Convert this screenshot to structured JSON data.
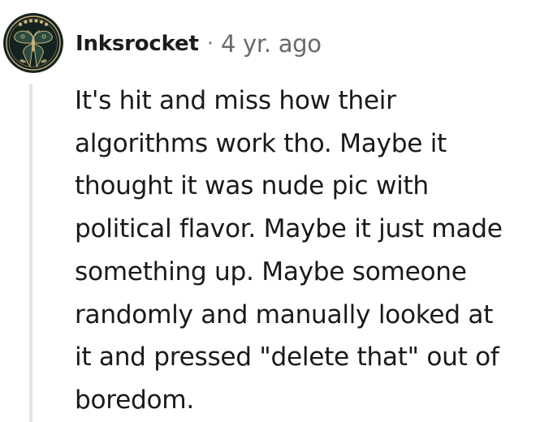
{
  "comment": {
    "username": "Inksrocket",
    "separator": "·",
    "age": "4 yr. ago",
    "avatar_icon": "luna-moth-icon",
    "body_lines": [
      "It's hit and miss how their",
      "algorithms work tho. Maybe it",
      "thought it was nude pic with",
      "political flavor. Maybe it just made",
      "something up. Maybe someone",
      "randomly and manually looked at",
      "it and pressed \"delete that\" out of",
      "boredom."
    ]
  },
  "colors": {
    "avatar_background": "#14231f",
    "avatar_gold": "#c9b27a",
    "thread_line": "#e4e4e4",
    "username": "#1c1c1c",
    "meta": "#6a6a6a"
  }
}
